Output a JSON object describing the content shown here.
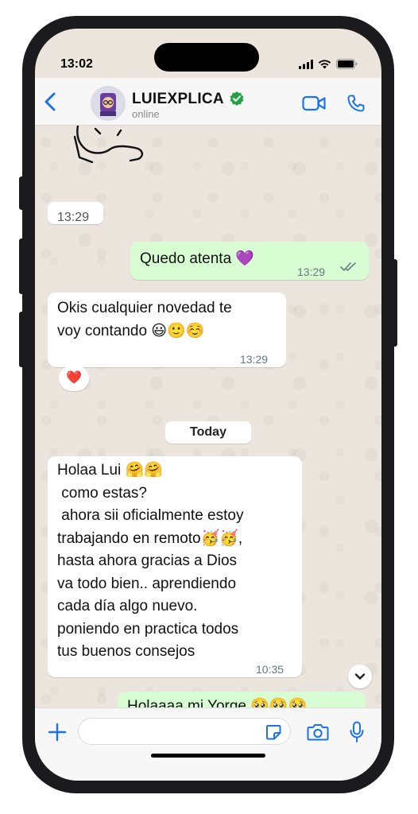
{
  "status_bar": {
    "time": "13:02"
  },
  "header": {
    "contact_name": "LUIEXPLICA",
    "contact_status": "online"
  },
  "messages": [
    {
      "direction": "in",
      "type": "sticker",
      "time": "13:29"
    },
    {
      "direction": "out",
      "text": "Quedo atenta 💜",
      "time": "13:29",
      "read_receipt": "double-check"
    },
    {
      "direction": "in",
      "lines": [
        "Okis cualquier novedad te",
        "voy contando 😃🙂☺️"
      ],
      "time": "13:29",
      "reaction": "❤️"
    },
    {
      "direction": "in",
      "lines": [
        "Holaa Lui 🤗🤗",
        " como estas?",
        " ahora sii oficialmente estoy",
        "trabajando en remoto🥳🥳,",
        "hasta ahora gracias a Dios",
        "va todo bien.. aprendiendo",
        "cada día algo nuevo.",
        "poniendo en practica todos",
        "tus buenos consejos"
      ],
      "time": "10:35"
    },
    {
      "direction": "out",
      "text": "Holaaaa mi Yorge 🥺🥺🥺"
    }
  ],
  "day_separator": "Today",
  "colors": {
    "accent": "#1a73e8",
    "outgoing_bubble": "#d9fdd3",
    "incoming_bubble": "#ffffff",
    "chat_background": "#ece5dd",
    "verified_badge": "#25a244"
  },
  "icons": [
    "back-chevron-icon",
    "verified-badge-icon",
    "video-call-icon",
    "phone-call-icon",
    "plus-icon",
    "sticker-icon",
    "camera-icon",
    "microphone-icon",
    "chevron-down-icon",
    "heart-icon",
    "double-check-icon"
  ]
}
